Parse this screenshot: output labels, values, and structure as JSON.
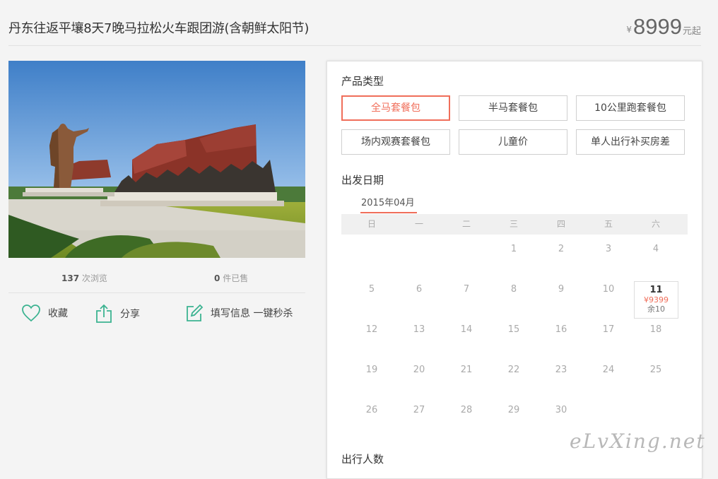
{
  "header": {
    "title": "丹东往返平壤8天7晚马拉松火车跟团游(含朝鲜太阳节)",
    "price_symbol": "¥",
    "price": "8999",
    "price_suffix": "元起"
  },
  "stats": {
    "views_count": "137",
    "views_label": "次浏览",
    "sold_count": "0",
    "sold_label": "件已售"
  },
  "actions": {
    "favorite": "收藏",
    "share": "分享",
    "fill_info": "填写信息 一键秒杀"
  },
  "product": {
    "section_title": "产品类型",
    "options": [
      "全马套餐包",
      "半马套餐包",
      "10公里跑套餐包",
      "场内观赛套餐包",
      "儿童价",
      "单人出行补买房差"
    ],
    "selected": "全马套餐包"
  },
  "departure": {
    "section_title": "出发日期",
    "month": "2015年04月",
    "weekdays": [
      "日",
      "一",
      "二",
      "三",
      "四",
      "五",
      "六"
    ],
    "days": [
      "1",
      "2",
      "3",
      "4",
      "5",
      "6",
      "7",
      "8",
      "9",
      "10",
      "11",
      "12",
      "13",
      "14",
      "15",
      "16",
      "17",
      "18",
      "19",
      "20",
      "21",
      "22",
      "23",
      "24",
      "25",
      "26",
      "27",
      "28",
      "29",
      "30"
    ],
    "available_day": {
      "day": "11",
      "price": "¥9399",
      "remain": "余10"
    }
  },
  "travelers": {
    "section_title": "出行人数"
  },
  "watermark": "eLvXing.net",
  "colors": {
    "accent": "#f06e5a",
    "icon": "#3cb391"
  }
}
